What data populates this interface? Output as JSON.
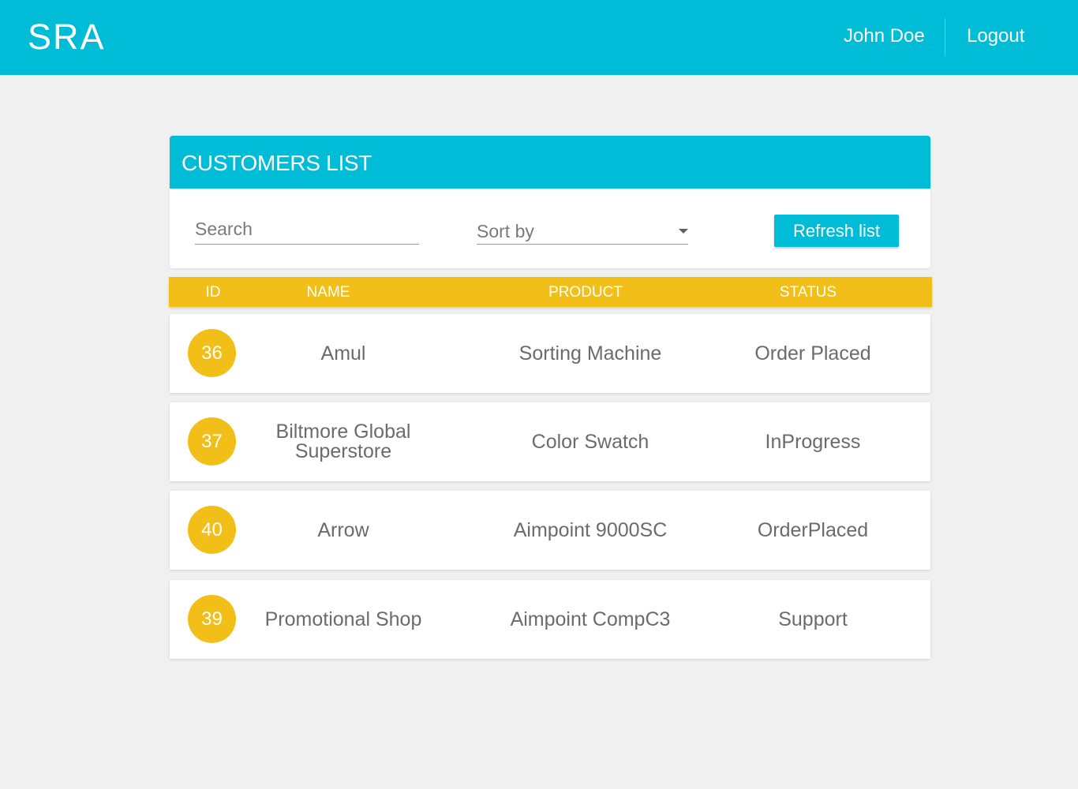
{
  "header": {
    "logo": "SRA",
    "user_name": "John Doe",
    "logout_label": "Logout"
  },
  "card": {
    "title": "CUSTOMERS LIST",
    "search_placeholder": "Search",
    "sort_label": "Sort by",
    "refresh_label": "Refresh list"
  },
  "table": {
    "columns": [
      "ID",
      "NAME",
      "PRODUCT",
      "STATUS"
    ],
    "rows": [
      {
        "id": "36",
        "name": "Amul",
        "product": "Sorting Machine",
        "status": "Order Placed"
      },
      {
        "id": "37",
        "name": "Biltmore Global Superstore",
        "product": "Color Swatch",
        "status": "InProgress"
      },
      {
        "id": "40",
        "name": "Arrow",
        "product": "Aimpoint 9000SC",
        "status": "OrderPlaced"
      },
      {
        "id": "39",
        "name": "Promotional Shop",
        "product": "Aimpoint CompC3",
        "status": "Support"
      }
    ]
  },
  "colors": {
    "primary": "#00bcd6",
    "accent": "#f2bf18",
    "background": "#f0f0f0",
    "text": "#6b6b6b"
  }
}
